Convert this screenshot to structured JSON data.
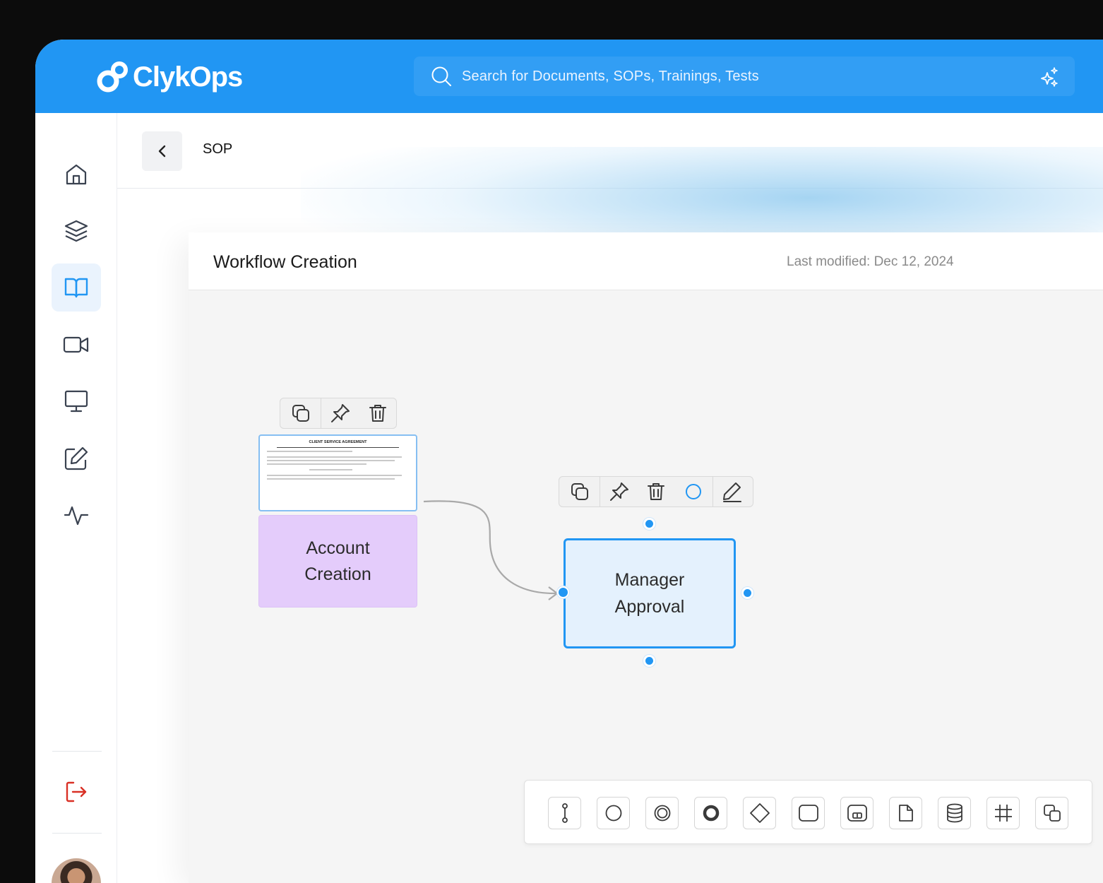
{
  "app": {
    "name": "ClykOps"
  },
  "search": {
    "placeholder": "Search for Documents, SOPs, Trainings, Tests"
  },
  "sidebar": {
    "items": [
      {
        "name": "home",
        "icon": "home-icon",
        "active": false
      },
      {
        "name": "layers",
        "icon": "layers-icon",
        "active": false
      },
      {
        "name": "sop",
        "icon": "book-open-icon",
        "active": true
      },
      {
        "name": "trainings",
        "icon": "video-icon",
        "active": false
      },
      {
        "name": "presentations",
        "icon": "monitor-icon",
        "active": false
      },
      {
        "name": "tests",
        "icon": "edit-icon",
        "active": false
      },
      {
        "name": "activity",
        "icon": "activity-icon",
        "active": false
      }
    ],
    "logout_icon": "logout-icon"
  },
  "header": {
    "breadcrumb": "SOP"
  },
  "card": {
    "title": "Workflow Creation",
    "last_modified": "Last modified: Dec 12, 2024"
  },
  "canvas": {
    "doc_preview": {
      "title": "CLIENT SERVICE AGREEMENT"
    },
    "nodes": [
      {
        "id": "account",
        "line1": "Account",
        "line2": "Creation",
        "color": "#e4ccfb"
      },
      {
        "id": "manager",
        "line1": "Manager",
        "line2": "Approval",
        "color": "#e4f1fd"
      }
    ],
    "toolbar_small": [
      "duplicate-icon",
      "pin-icon",
      "trash-icon"
    ],
    "toolbar_large": [
      "duplicate-icon",
      "pin-icon",
      "trash-icon",
      "circle-color-icon",
      "pen-icon"
    ]
  },
  "shapes": [
    "connector-icon",
    "circle-icon",
    "double-circle-icon",
    "thick-circle-icon",
    "diamond-icon",
    "rounded-rect-icon",
    "subprocess-icon",
    "document-icon",
    "database-icon",
    "grid-icon",
    "group-icon"
  ],
  "colors": {
    "brand": "#2196f3",
    "logout": "#d93025"
  }
}
